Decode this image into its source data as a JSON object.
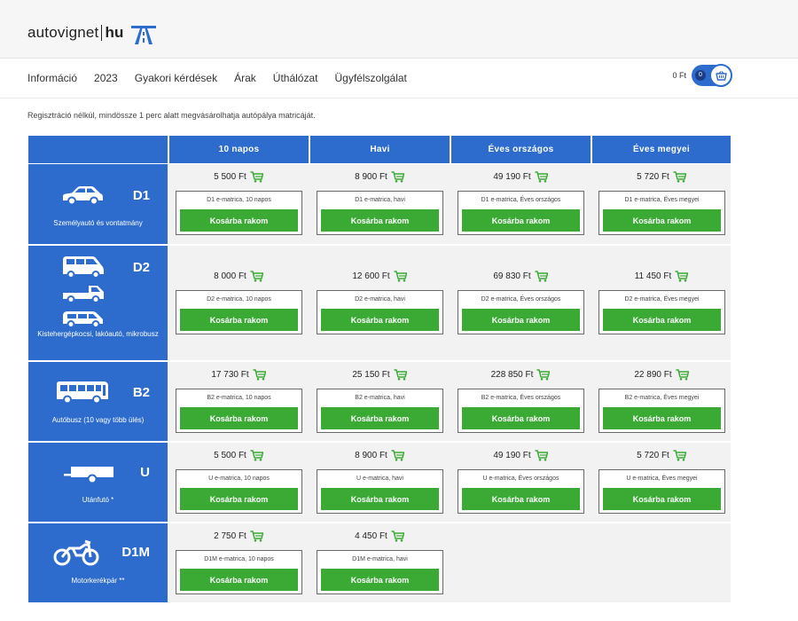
{
  "brand": {
    "name": "autovignet",
    "suffix": "hu",
    "accent": "#2d6bcd",
    "green": "#3aaa35"
  },
  "nav": {
    "items": [
      "Információ",
      "2023",
      "Gyakori kérdések",
      "Árak",
      "Úthálózat",
      "Ügyfélszolgálat"
    ]
  },
  "cart": {
    "total": "0 Ft",
    "count": "0"
  },
  "notice": "Regisztráció nélkül, mindössze 1 perc alatt megvásárolhatja autópálya matricáját.",
  "table": {
    "headers": [
      "10 napos",
      "Havi",
      "Éves országos",
      "Éves megyei"
    ],
    "button_label": "Kosárba rakom",
    "rows": [
      {
        "code": "D1",
        "desc": "Személyautó és vontatmány",
        "icon": "car-icon",
        "cells": [
          {
            "price": "5 500 Ft",
            "label": "D1 e-matrica, 10 napos"
          },
          {
            "price": "8 900 Ft",
            "label": "D1 e-matrica, havi"
          },
          {
            "price": "49 190 Ft",
            "label": "D1 e-matrica, Éves országos"
          },
          {
            "price": "5 720 Ft",
            "label": "D1 e-matrica, Éves megyei"
          }
        ]
      },
      {
        "code": "D2",
        "desc": "Kistehergépkocsi, lakóautó, mikrobusz",
        "icon": "van-icon",
        "cells": [
          {
            "price": "8 000 Ft",
            "label": "D2 e-matrica, 10 napos"
          },
          {
            "price": "12 600 Ft",
            "label": "D2 e-matrica, havi"
          },
          {
            "price": "69 830 Ft",
            "label": "D2 e-matrica, Éves országos"
          },
          {
            "price": "11 450 Ft",
            "label": "D2 e-matrica, Éves megyei"
          }
        ]
      },
      {
        "code": "B2",
        "desc": "Autóbusz (10 vagy több ülés)",
        "icon": "bus-icon",
        "cells": [
          {
            "price": "17 730 Ft",
            "label": "B2 e-matrica, 10 napos"
          },
          {
            "price": "25 150 Ft",
            "label": "B2 e-matrica, havi"
          },
          {
            "price": "228 850 Ft",
            "label": "B2 e-matrica, Éves országos"
          },
          {
            "price": "22 890 Ft",
            "label": "B2 e-matrica, Éves megyei"
          }
        ]
      },
      {
        "code": "U",
        "desc": "Utánfutó *",
        "icon": "trailer-icon",
        "cells": [
          {
            "price": "5 500 Ft",
            "label": "U e-matrica, 10 napos"
          },
          {
            "price": "8 900 Ft",
            "label": "U e-matrica, havi"
          },
          {
            "price": "49 190 Ft",
            "label": "U e-matrica, Éves országos"
          },
          {
            "price": "5 720 Ft",
            "label": "U e-matrica, Éves megyei"
          }
        ]
      },
      {
        "code": "D1M",
        "desc": "Motorkerékpár **",
        "icon": "motorcycle-icon",
        "cells": [
          {
            "price": "2 750 Ft",
            "label": "D1M e-matrica, 10 napos"
          },
          {
            "price": "4 450 Ft",
            "label": "D1M e-matrica, havi"
          }
        ]
      }
    ]
  }
}
